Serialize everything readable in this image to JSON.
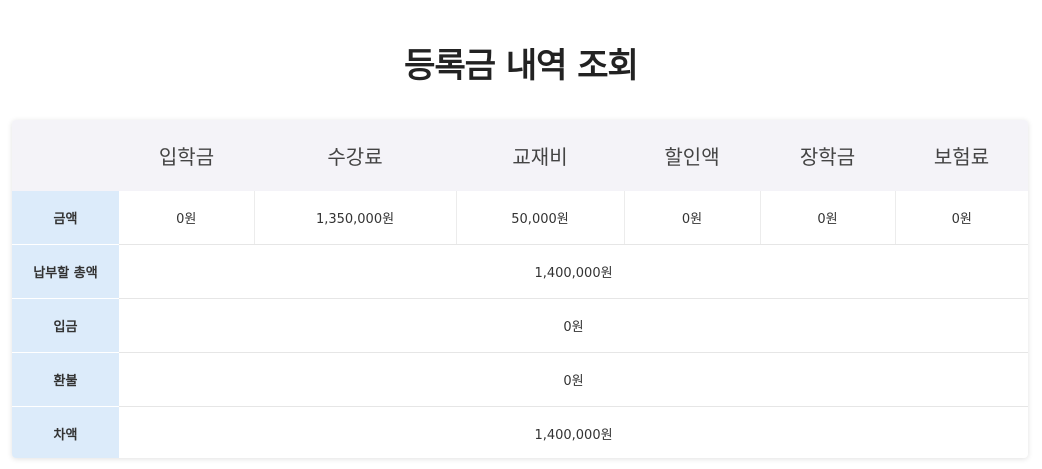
{
  "page": {
    "title": "등록금 내역 조회"
  },
  "table": {
    "columns": [
      "",
      "입학금",
      "수강료",
      "교재비",
      "할인액",
      "장학금",
      "보험료"
    ],
    "amount_row": {
      "label": "금액",
      "values": [
        "0원",
        "1,350,000원",
        "50,000원",
        "0원",
        "0원",
        "0원"
      ]
    },
    "summary_rows": [
      {
        "label": "납부할 총액",
        "value": "1,400,000원"
      },
      {
        "label": "입금",
        "value": "0원"
      },
      {
        "label": "환불",
        "value": "0원"
      },
      {
        "label": "차액",
        "value": "1,400,000원"
      }
    ]
  }
}
